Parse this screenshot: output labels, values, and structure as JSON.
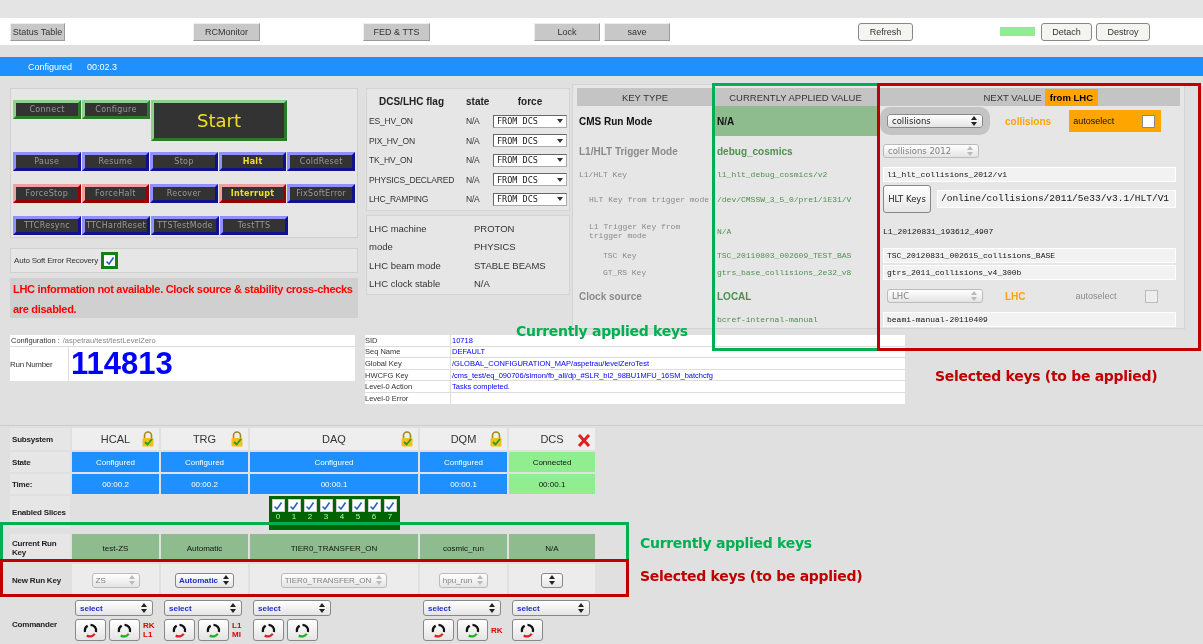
{
  "toolbar": {
    "left": [
      {
        "label": "Status Table"
      },
      {
        "label": "RCMonitor"
      },
      {
        "label": "FED & TTS"
      },
      {
        "label": "Lock"
      },
      {
        "label": "save"
      }
    ],
    "right": [
      {
        "label": "Refresh"
      }
    ],
    "window": [
      {
        "label": "Detach"
      },
      {
        "label": "Destroy"
      }
    ]
  },
  "status_bar": {
    "state": "Configured",
    "time": "00:02.3"
  },
  "commands": [
    {
      "buttons": [
        {
          "label": "Connect",
          "kind": "green",
          "enabled": false
        },
        {
          "label": "Configure",
          "kind": "green",
          "enabled": false
        },
        {
          "label": "Start",
          "kind": "start",
          "enabled": true
        }
      ]
    },
    {
      "buttons": [
        {
          "label": "Pause",
          "kind": "blue",
          "enabled": false
        },
        {
          "label": "Resume",
          "kind": "blue",
          "enabled": false
        },
        {
          "label": "Stop",
          "kind": "blue",
          "enabled": false
        },
        {
          "label": "Halt",
          "kind": "blue",
          "enabled": true
        },
        {
          "label": "ColdReset",
          "kind": "blue",
          "enabled": false
        }
      ]
    },
    {
      "buttons": [
        {
          "label": "ForceStop",
          "kind": "red",
          "enabled": false
        },
        {
          "label": "ForceHalt",
          "kind": "red",
          "enabled": false
        },
        {
          "label": "Recover",
          "kind": "blue",
          "enabled": false
        },
        {
          "label": "Interrupt",
          "kind": "red",
          "enabled": true
        },
        {
          "label": "FixSoftError",
          "kind": "blue",
          "enabled": false
        }
      ]
    },
    {
      "buttons": [
        {
          "label": "TTCResync",
          "kind": "blue",
          "enabled": false
        },
        {
          "label": "TTCHardReset",
          "kind": "blue",
          "enabled": false
        },
        {
          "label": "TTSTestMode",
          "kind": "blue",
          "enabled": false
        },
        {
          "label": "TestTTS",
          "kind": "blue",
          "enabled": false
        }
      ]
    }
  ],
  "auto_recovery": {
    "label": "Auto Soft Error Recovery",
    "checked": true
  },
  "warning": "LHC information not available. Clock source & stability cross-checks are disabled.",
  "dcs_flags": {
    "columns": [
      "DCS/LHC flag",
      "state",
      "force"
    ],
    "rows": [
      {
        "flag": "ES_HV_ON",
        "state": "N/A",
        "force": "FROM DCS"
      },
      {
        "flag": "PIX_HV_ON",
        "state": "N/A",
        "force": "FROM DCS"
      },
      {
        "flag": "TK_HV_ON",
        "state": "N/A",
        "force": "FROM DCS"
      },
      {
        "flag": "PHYSICS_DECLARED",
        "state": "N/A",
        "force": "FROM DCS"
      },
      {
        "flag": "LHC_RAMPING",
        "state": "N/A",
        "force": "FROM DCS"
      }
    ]
  },
  "lhc_info": [
    {
      "label": "LHC machine",
      "value": "PROTON"
    },
    {
      "label": "mode",
      "value": "PHYSICS"
    },
    {
      "label": "LHC beam mode",
      "value": "STABLE BEAMS"
    },
    {
      "label": "LHC clock stable",
      "value": "N/A"
    }
  ],
  "keys": {
    "columns": [
      "KEY TYPE",
      "CURRENTLY APPLIED VALUE",
      "NEXT VALUE"
    ],
    "next_badge": "from LHC",
    "rows": [
      {
        "label": "CMS Run Mode",
        "kind": "select",
        "disabled": false,
        "highlighted": true,
        "current": "N/A",
        "next": {
          "value": "collisions",
          "disabled": false,
          "source": "collisions",
          "autoselect": {
            "label": "autoselect",
            "checked": false,
            "disabled": false
          }
        }
      },
      {
        "label": "L1/HLT Trigger Mode",
        "kind": "select",
        "disabled": true,
        "highlighted": false,
        "current": "debug_cosmics",
        "next": {
          "value": "collisions 2012",
          "disabled": true
        }
      },
      {
        "label": "L1/HLT Key",
        "kind": "field",
        "disabled": true,
        "highlighted": false,
        "current": "l1_hlt_debug_cosmics/v2",
        "next": {
          "value": "l1_hlt_collisions_2012/v1"
        },
        "children": [
          {
            "label": "HLT Key from trigger mode",
            "kind": "hlt",
            "disabled": true,
            "highlighted": false,
            "current": "/dev/CMSSW_3_5_0/pre1/1E31/V",
            "next": {
              "button": "HLT Keys",
              "value": "/online/collisions/2011/5e33/v3.1/HLT/V1"
            }
          },
          {
            "label": "L1 Trigger Key from trigger mode",
            "kind": "plain",
            "disabled": true,
            "highlighted": false,
            "current": "N/A",
            "next": {
              "value": "L1_20120831_193612_4907"
            },
            "children": [
              {
                "label": "TSC Key",
                "kind": "field",
                "disabled": true,
                "highlighted": false,
                "current": "TSC_20110803_002609_TEST_BAS",
                "next": {
                  "value": "TSC_20120831_002615_collisions_BASE"
                }
              },
              {
                "label": "GT_RS Key",
                "kind": "field",
                "disabled": true,
                "highlighted": false,
                "current": "gtrs_base_collisions_2e32_v8",
                "next": {
                  "value": "gtrs_2011_collisions_v4_300b"
                }
              }
            ]
          }
        ]
      },
      {
        "label": "Clock source",
        "kind": "select",
        "disabled": true,
        "highlighted": false,
        "current": "LOCAL",
        "next": {
          "value": "LHC",
          "disabled": true,
          "source": "LHC",
          "autoselect": {
            "label": "autoselect",
            "checked": false,
            "disabled": true
          }
        }
      },
      {
        "kind": "field",
        "highlighted": false,
        "current": "bcref-internal-manual",
        "next": {
          "value": "beami-manual-20110409"
        }
      }
    ]
  },
  "config": {
    "label": "Configuration :",
    "path": "/aspetrau/test/testLevelZero",
    "run_label": "Run Number",
    "run_number": "114813"
  },
  "session_info": [
    {
      "label": "SID",
      "value": "10718"
    },
    {
      "label": "Seq Name",
      "value": "DEFAULT"
    },
    {
      "label": "Global Key",
      "value": "/GLOBAL_CONFIGURATION_MAP/aspetrau/levelZeroTest"
    },
    {
      "label": "HWCFG Key",
      "value": "/cms_test/eq_090706/simon/fb_all/dp_#SLR_bl2_98BU1MFU_16SM_batchcfg"
    },
    {
      "label": "Level-0 Action",
      "value": "Tasks completed."
    },
    {
      "label": "Level-0 Error"
    }
  ],
  "subsystems": {
    "row_labels": {
      "subsystem": "Subsystem",
      "state": "State",
      "time": "Time:",
      "slices": "Enabled Slices",
      "current_key": "Current Run Key",
      "new_key": "New Run Key",
      "commander": "Commander"
    },
    "items": [
      {
        "name": "HCAL",
        "locked": true,
        "state": "Configured",
        "color": "#1e90ff",
        "time": "00:00.2",
        "current_key": "test-ZS",
        "new_key": {
          "value": "ZS",
          "disabled": true
        },
        "commander": {
          "select": "select",
          "buttons": [
            {
              "kind": "red"
            },
            {
              "kind": "green"
            }
          ],
          "flags": [
            "RK",
            "L1"
          ]
        }
      },
      {
        "name": "TRG",
        "locked": true,
        "state": "Configured",
        "color": "#1e90ff",
        "time": "00:00.2",
        "current_key": "Automatic",
        "new_key": {
          "value": "Automatic",
          "disabled": false
        },
        "commander": {
          "select": "select",
          "buttons": [
            {
              "kind": "red"
            },
            {
              "kind": "green"
            }
          ],
          "flags": [
            "L1",
            "MI"
          ]
        }
      },
      {
        "name": "DAQ",
        "locked": true,
        "state": "Configured",
        "color": "#1e90ff",
        "time": "00:00.1",
        "slices": [
          {
            "label": "0",
            "checked": true
          },
          {
            "label": "1",
            "checked": true
          },
          {
            "label": "2",
            "checked": true
          },
          {
            "label": "3",
            "checked": true
          },
          {
            "label": "4",
            "checked": true
          },
          {
            "label": "5",
            "checked": true
          },
          {
            "label": "6",
            "checked": true
          },
          {
            "label": "7",
            "checked": true
          }
        ],
        "current_key": "TIER0_TRANSFER_ON",
        "new_key": {
          "value": "TIER0_TRANSFER_ON",
          "disabled": true
        },
        "commander": {
          "select": "select",
          "buttons": [
            {
              "kind": "red"
            },
            {
              "kind": "green"
            }
          ]
        }
      },
      {
        "name": "DQM",
        "locked": true,
        "state": "Configured",
        "color": "#1e90ff",
        "time": "00:00.1",
        "current_key": "cosmic_run",
        "new_key": {
          "value": "hpu_run",
          "disabled": true
        },
        "commander": {
          "select": "select",
          "buttons": [
            {
              "kind": "red"
            },
            {
              "kind": "green"
            }
          ],
          "flags": [
            "RK"
          ]
        }
      },
      {
        "name": "DCS",
        "locked": false,
        "state": "Connected",
        "color": "#90ee90",
        "time": "00:00.1",
        "current_key": "N/A",
        "new_key": {
          "disabled": false
        },
        "commander": {
          "select": "select",
          "buttons": [
            {
              "kind": "red"
            }
          ]
        }
      }
    ]
  },
  "annotations": [
    {
      "kind": "applied",
      "label": "Currently applied keys"
    },
    {
      "kind": "selected",
      "label": "Selected keys (to be applied)"
    },
    {
      "kind": "applied",
      "label": "Currently applied keys"
    },
    {
      "kind": "selected",
      "label": "Selected keys (to be applied)"
    }
  ]
}
